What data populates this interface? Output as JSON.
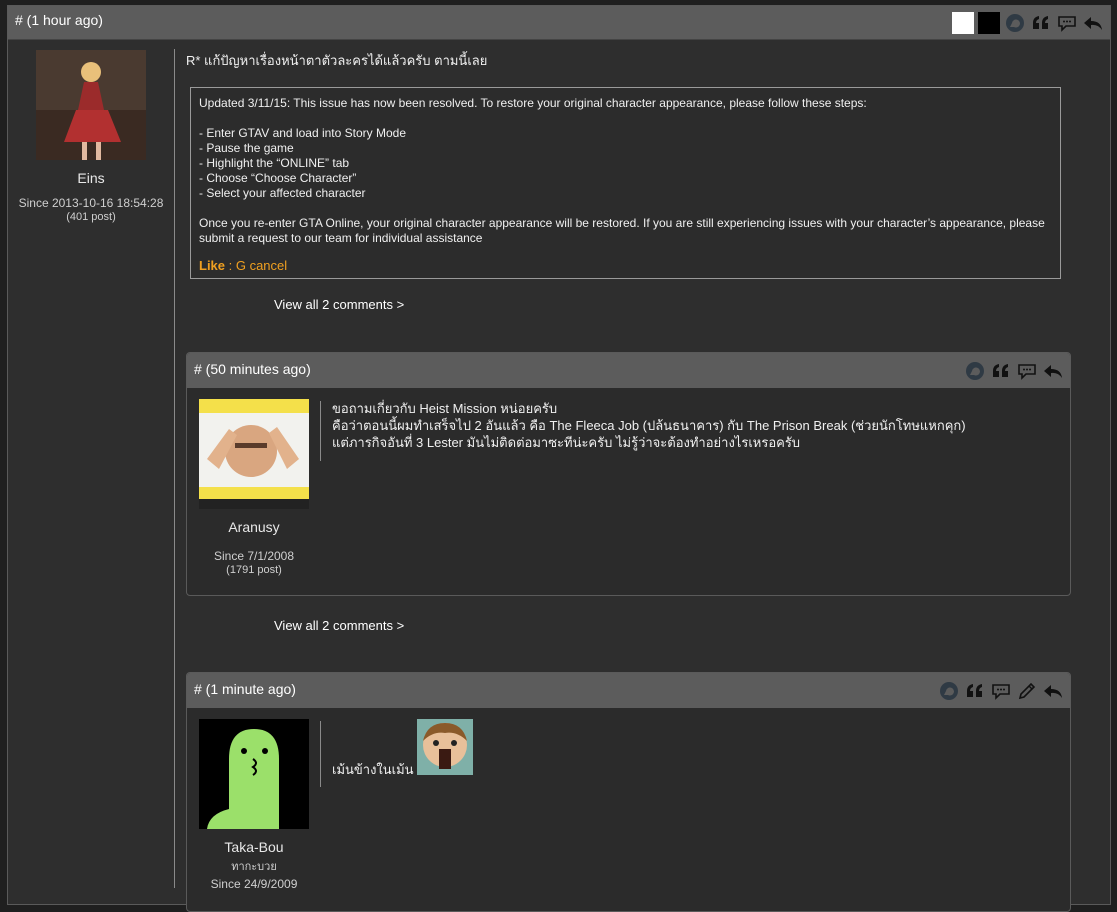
{
  "post": {
    "header": "# (1 hour ago)",
    "author": {
      "name": "Eins",
      "since": "Since 2013-10-16 18:54:28",
      "count": "(401 post)"
    },
    "text": "R* แก้ปัญหาเรื่องหน้าตาตัวละครได้แล้วครับ ตามนี้เลย",
    "quote": {
      "lines": [
        "Updated 3/11/15: This issue has now been resolved. To restore your original character appearance, please follow these steps:",
        "",
        "- Enter GTAV and load into Story Mode",
        "- Pause the game",
        "- Highlight the “ONLINE” tab",
        "- Choose “Choose Character”",
        "- Select your affected character",
        "",
        "Once you re-enter GTA Online, your original character appearance will be restored. If you are still experiencing issues with your character’s appearance, please submit a request to our team for individual assistance"
      ],
      "like_label": "Like",
      "like_rest": " : G cancel"
    },
    "view_all": "View all 2 comments >"
  },
  "comment1": {
    "header": "# (50 minutes ago)",
    "author": {
      "name": "Aranusy",
      "since": "Since 7/1/2008",
      "count": "(1791 post)"
    },
    "lines": [
      "ขอถามเกี่ยวกับ Heist Mission หน่อยครับ",
      "คือว่าตอนนี้ผมทำเสร็จไป 2 อันแล้ว คือ The Fleeca Job (ปล้นธนาคาร) กับ The Prison Break (ช่วยนักโทษแหกคุก)",
      "แต่ภารกิจอันที่ 3 Lester มันไม่ติดต่อมาซะทีน่ะครับ ไม่รู้ว่าจะต้องทำอย่างไรเหรอครับ"
    ],
    "view_all": "View all 2 comments >"
  },
  "comment2": {
    "header": "# (1 minute ago)",
    "author": {
      "name": "Taka-Bou",
      "subtitle": "ทากะบวย",
      "since": "Since 24/9/2009"
    },
    "text": "เม้นข้างในเม้น"
  },
  "icons": [
    "square-white-icon",
    "square-black-icon",
    "speech-bubble-icon",
    "quote-icon",
    "comment-icon",
    "edit-icon",
    "reply-icon"
  ]
}
